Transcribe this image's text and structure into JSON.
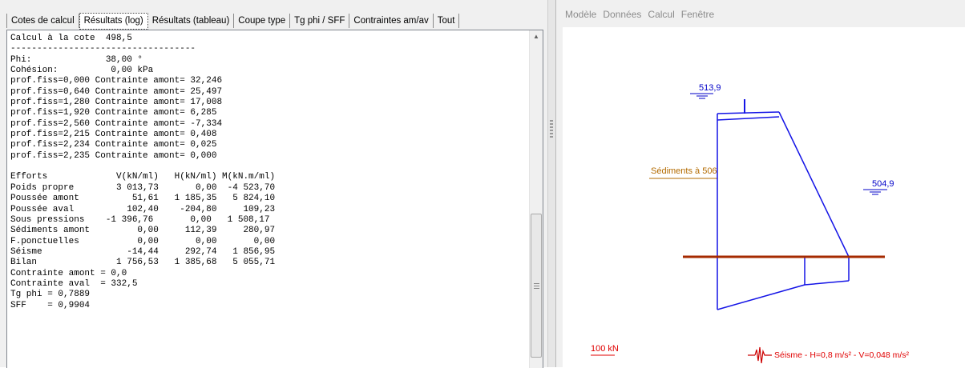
{
  "tabs": [
    {
      "label": "Cotes de calcul"
    },
    {
      "label": "Résultats (log)"
    },
    {
      "label": "Résultats (tableau)"
    },
    {
      "label": "Coupe type"
    },
    {
      "label": "Tg phi / SFF"
    },
    {
      "label": "Contraintes am/av"
    },
    {
      "label": "Tout"
    }
  ],
  "log": {
    "lines": [
      "Calcul à la cote  498,5",
      "-----------------------------------",
      "Phi:              38,00 °",
      "Cohésion:          0,00 kPa",
      "prof.fiss=0,000 Contrainte amont= 32,246",
      "prof.fiss=0,640 Contrainte amont= 25,497",
      "prof.fiss=1,280 Contrainte amont= 17,008",
      "prof.fiss=1,920 Contrainte amont= 6,285",
      "prof.fiss=2,560 Contrainte amont= -7,334",
      "prof.fiss=2,215 Contrainte amont= 0,408",
      "prof.fiss=2,234 Contrainte amont= 0,025",
      "prof.fiss=2,235 Contrainte amont= 0,000",
      "",
      "Efforts             V(kN/ml)   H(kN/ml) M(kN.m/ml)",
      "Poids propre        3 013,73       0,00  -4 523,70",
      "Poussée amont          51,61   1 185,35   5 824,10",
      "Poussée aval          102,40    -204,80     109,23",
      "Sous pressions    -1 396,76       0,00   1 508,17",
      "Sédiments amont         0,00     112,39     280,97",
      "F.ponctuelles           0,00       0,00       0,00",
      "Séisme                -14,44     292,74   1 856,95",
      "Bilan               1 756,53   1 385,68   5 055,71",
      "Contrainte amont = 0,0",
      "Contrainte aval  = 332,5",
      "Tg phi = 0,7889",
      "SFF    = 0,9904"
    ]
  },
  "menu": [
    "Modèle",
    "Données",
    "Calcul",
    "Fenêtre"
  ],
  "drawing": {
    "upstream_level": "513,9",
    "downstream_level": "504,9",
    "sediments_label": "Sédiments à 506",
    "force_scale_label": "100 kN",
    "seismic_label": "Séisme - H=0,8 m/s² - V=0,048 m/s²",
    "colors": {
      "dam": "#1414e6",
      "water": "#0000c8",
      "sediment": "#b36b00",
      "foundation": "#a52a00",
      "scale": "#e00000"
    }
  }
}
